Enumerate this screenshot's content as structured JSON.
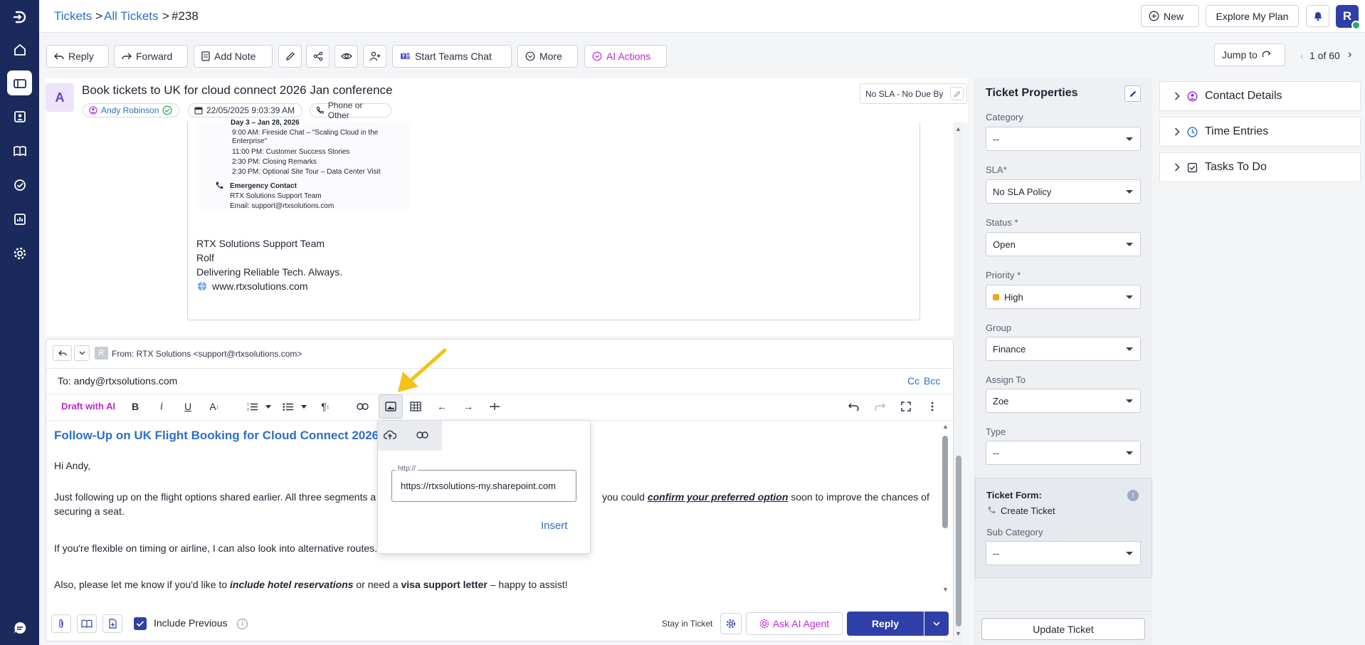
{
  "breadcrumb": {
    "tickets": "Tickets",
    "sep1": ">",
    "all": "All Tickets",
    "sep2": ">",
    "id": "#238"
  },
  "topbar": {
    "new_label": "New",
    "explore_label": "Explore My Plan",
    "avatar_letter": "R"
  },
  "toolbar": {
    "reply": "Reply",
    "forward": "Forward",
    "add_note": "Add Note",
    "teams": "Start Teams Chat",
    "more": "More",
    "ai_actions": "AI Actions",
    "jump_to": "Jump to",
    "pager": "1 of 60"
  },
  "ticket": {
    "avatar_letter": "A",
    "title": "Book tickets to UK for cloud connect 2026 Jan conference",
    "requester": "Andy Robinson",
    "date": "22/05/2025 9:03:39 AM",
    "source": "Phone or Other",
    "sla_badge": "No SLA - No Due By"
  },
  "email_image": {
    "day": "Day 3 – Jan 28, 2026",
    "l1": "9:00 AM: Fireside Chat – \"Scaling Cloud in the",
    "l1b": "Enterprise\"",
    "l2": "11:00 PM:  Customer Success Stories",
    "l3": "2:30 PM: Closing Remarks",
    "l4": "2:30 PM: Optional Site Tour – Data Center Visit",
    "contact_title": "Emergency Contact",
    "contact_team": "RTX Solutions Support Team",
    "contact_email": "Email: support@rtxsolutions.com"
  },
  "signature": {
    "team": "RTX Solutions Support Team",
    "name": "Rolf",
    "tagline": "Delivering Reliable Tech. Always.",
    "website": "www.rtxsolutions.com"
  },
  "editor": {
    "from_badge": "R",
    "from": "From:  RTX Solutions <support@rtxsolutions.com>",
    "to": "To: andy@rtxsolutions.com",
    "cc": "Cc",
    "bcc": "Bcc",
    "draft_ai": "Draft with AI",
    "heading": "Follow-Up on UK Flight Booking for Cloud Connect 2026",
    "greeting": "Hi Andy,",
    "p1_a": "Just following up on the flight options shared earlier. All three segments a",
    "p1_b": "you could",
    "p1_em": "confirm your preferred option",
    "p1_c": "soon to improve the chances of",
    "p1_d": "securing a seat.",
    "p2": "If you're flexible on timing or airline, I can also look into alternative routes.",
    "p3_a": "Also, please let me know if you'd like to",
    "p3_em": "include hotel reservations",
    "p3_b": "or need a",
    "p3_strong": "visa support letter",
    "p3_c": "– happy to assist!",
    "include_previous": "Include Previous",
    "stay_in_ticket": "Stay in Ticket",
    "ask_ai": "Ask AI Agent",
    "reply": "Reply"
  },
  "image_popup": {
    "field_label": "http://",
    "url_value": "https://rtxsolutions-my.sharepoint.com",
    "insert": "Insert"
  },
  "properties": {
    "title": "Ticket Properties",
    "category_label": "Category",
    "category_value": "--",
    "sla_label": "SLA",
    "sla_value": "No SLA Policy",
    "status_label": "Status",
    "status_value": "Open",
    "priority_label": "Priority",
    "priority_value": "High",
    "priority_color": "#f5a623",
    "group_label": "Group",
    "group_value": "Finance",
    "assign_label": "Assign To",
    "assign_value": "Zoe",
    "type_label": "Type",
    "type_value": "--",
    "form_label": "Ticket Form:",
    "form_value": "Create Ticket",
    "subcat_label": "Sub Category",
    "subcat_value": "--",
    "required_mark": "*",
    "update": "Update Ticket"
  },
  "right_panel": {
    "contact": "Contact Details",
    "time": "Time Entries",
    "tasks": "Tasks To Do"
  },
  "colors": {
    "nav": "#1b2a5c",
    "accent": "#2f3fa8",
    "link": "#2d6fc9",
    "ai": "#c026d3",
    "arrow": "#f2c21b"
  }
}
